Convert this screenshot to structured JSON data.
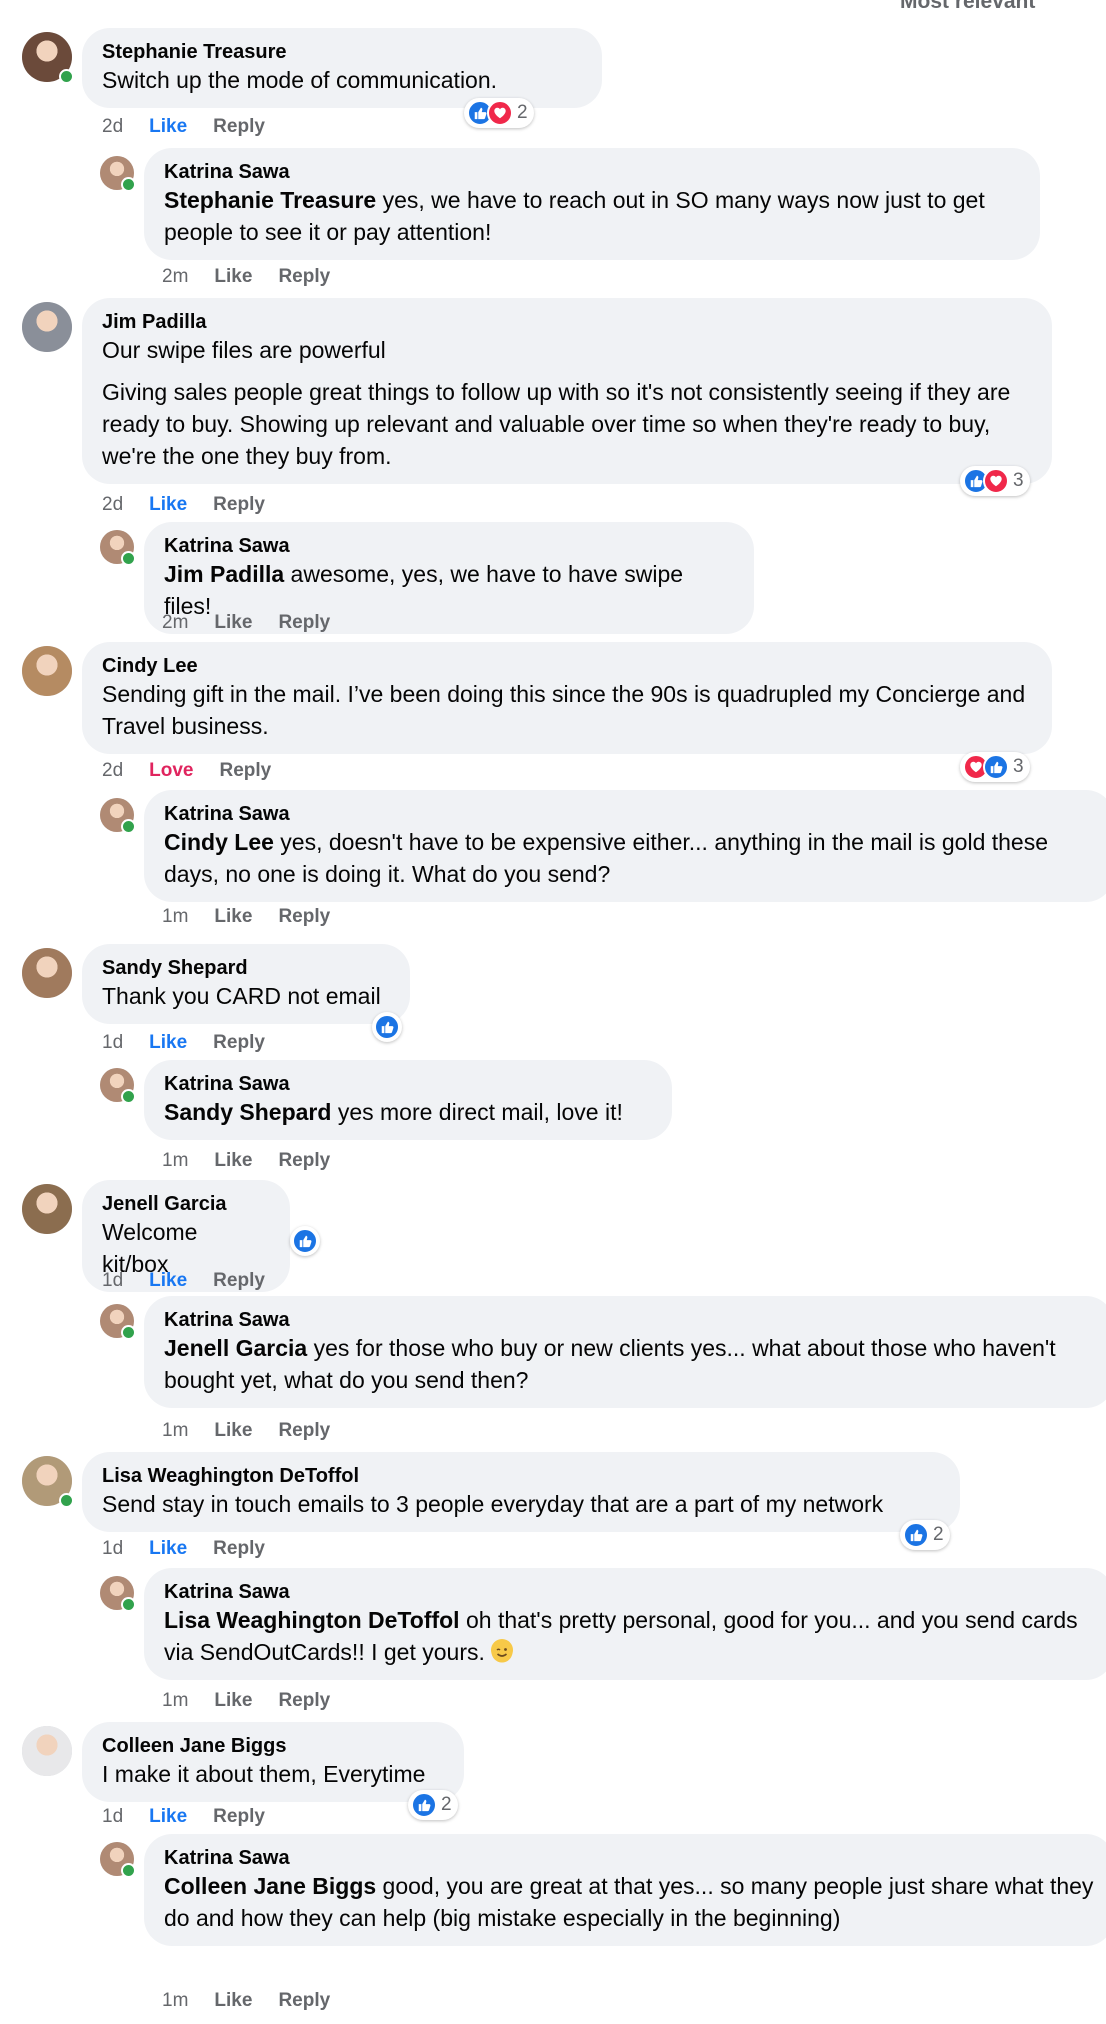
{
  "header": {
    "sort_label_clipped": "Most relevant"
  },
  "threads": [
    {
      "comment": {
        "author": "Stephanie Treasure",
        "paragraphs": [
          "Switch up the mode of communication."
        ],
        "time": "2d",
        "like_label": "Like",
        "reply_label": "Reply",
        "reactions": [
          "like",
          "love"
        ],
        "reaction_count": "2",
        "online": true
      },
      "reply": {
        "author": "Katrina Sawa",
        "mention": "Stephanie Treasure",
        "text": " yes, we have to reach out in SO many ways now just to get people to see it or pay attention!",
        "time": "2m",
        "like_label": "Like",
        "reply_label": "Reply",
        "online": true
      }
    },
    {
      "comment": {
        "author": "Jim Padilla",
        "paragraphs": [
          "Our swipe files are powerful",
          "Giving sales people great things to follow up with so it's not consistently seeing if they are ready to buy. Showing up relevant and valuable over time so when they're ready to buy, we're the one they buy from."
        ],
        "time": "2d",
        "like_label": "Like",
        "reply_label": "Reply",
        "reactions": [
          "like",
          "love"
        ],
        "reaction_count": "3",
        "online": false
      },
      "reply": {
        "author": "Katrina Sawa",
        "mention": "Jim Padilla",
        "text": " awesome, yes, we have to have swipe files!",
        "time": "2m",
        "like_label": "Like",
        "reply_label": "Reply",
        "online": true
      }
    },
    {
      "comment": {
        "author": "Cindy Lee",
        "paragraphs": [
          "Sending gift in the mail. I’ve been doing this since the 90s is quadrupled my Concierge and Travel business."
        ],
        "time": "2d",
        "like_label": "Love",
        "reply_label": "Reply",
        "reactions": [
          "love",
          "like"
        ],
        "reaction_count": "3",
        "online": false
      },
      "reply": {
        "author": "Katrina Sawa",
        "mention": "Cindy Lee",
        "text": " yes, doesn't have to be expensive either... anything in the mail is gold these days, no one is doing it. What do you send?",
        "time": "1m",
        "like_label": "Like",
        "reply_label": "Reply",
        "online": true
      }
    },
    {
      "comment": {
        "author": "Sandy Shepard",
        "paragraphs": [
          "Thank you CARD not email"
        ],
        "time": "1d",
        "like_label": "Like",
        "reply_label": "Reply",
        "reactions": [
          "like"
        ],
        "reaction_count": "",
        "online": false
      },
      "reply": {
        "author": "Katrina Sawa",
        "mention": "Sandy Shepard",
        "text": " yes more direct mail, love it!",
        "time": "1m",
        "like_label": "Like",
        "reply_label": "Reply",
        "online": true
      }
    },
    {
      "comment": {
        "author": "Jenell Garcia",
        "paragraphs": [
          "Welcome kit/box"
        ],
        "time": "1d",
        "like_label": "Like",
        "reply_label": "Reply",
        "reactions": [
          "like"
        ],
        "reaction_count": "",
        "online": false
      },
      "reply": {
        "author": "Katrina Sawa",
        "mention": "Jenell Garcia",
        "text": " yes for those who buy or new clients yes... what about those who haven't bought yet, what do you send then?",
        "time": "1m",
        "like_label": "Like",
        "reply_label": "Reply",
        "online": true
      }
    },
    {
      "comment": {
        "author": "Lisa Weaghington DeToffol",
        "paragraphs": [
          "Send stay in touch emails to 3 people everyday that are a part of my network"
        ],
        "time": "1d",
        "like_label": "Like",
        "reply_label": "Reply",
        "reactions": [
          "like"
        ],
        "reaction_count": "2",
        "online": true
      },
      "reply": {
        "author": "Katrina Sawa",
        "mention": "Lisa Weaghington DeToffol",
        "text": " oh that's pretty personal, good for you... and you send cards via SendOutCards!! I get yours. ",
        "emoji": "winking-face",
        "time": "1m",
        "like_label": "Like",
        "reply_label": "Reply",
        "online": true
      }
    },
    {
      "comment": {
        "author": "Colleen Jane Biggs",
        "paragraphs": [
          "I make it about them, Everytime"
        ],
        "time": "1d",
        "like_label": "Like",
        "reply_label": "Reply",
        "reactions": [
          "like"
        ],
        "reaction_count": "2",
        "online": false
      },
      "reply": {
        "author": "Katrina Sawa",
        "mention": "Colleen Jane Biggs",
        "text": " good, you are great at that yes... so many people just share what they do and how they can help (big mistake especially in the beginning)",
        "time": "1m",
        "like_label": "Like",
        "reply_label": "Reply",
        "online": true
      }
    }
  ],
  "colors": {
    "bubble": "#f0f2f5",
    "name": "#050505",
    "meta": "#65676b",
    "like_blue": "#1877f2",
    "love_red": "#e0245e",
    "online_green": "#31a24c"
  }
}
